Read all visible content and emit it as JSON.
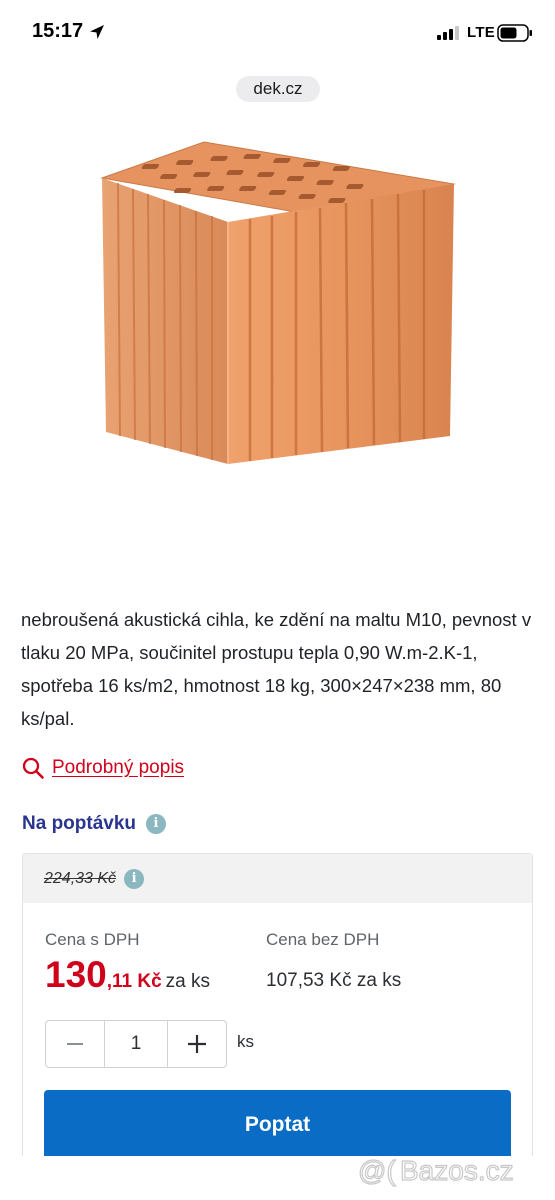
{
  "status_bar": {
    "time": "15:17",
    "network": "LTE",
    "icons": [
      "location-arrow-icon",
      "signal-icon",
      "battery-icon"
    ]
  },
  "browser": {
    "url": "dek.cz"
  },
  "product": {
    "image": "brick-image",
    "description": "nebroušená akustická cihla, ke zdění na maltu M10, pevnost v tlaku 20 MPa, součinitel prostupu tepla 0,90 W.m-2.K-1, spotřeba 16 ks/m2, hmotnost 18 kg, 300×247×238 mm, 80 ks/pal.",
    "detail_link": "Podrobný popis",
    "availability": "Na poptávku"
  },
  "price_card": {
    "old_price": "224,33 Kč",
    "price_vat_label": "Cena s DPH",
    "price_novat_label": "Cena bez DPH",
    "price_vat_integer": "130",
    "price_vat_decimal": ",11 Kč",
    "price_vat_suffix": "za ks",
    "price_novat": "107,53 Kč za ks",
    "quantity": "1",
    "unit": "ks",
    "submit_label": "Poptat"
  },
  "watermark": "@( Bazos.cz",
  "colors": {
    "accent_red": "#d0021b",
    "navy": "#2a3590",
    "button_blue": "#0a6cc4",
    "info_teal": "#8ab7c0"
  }
}
